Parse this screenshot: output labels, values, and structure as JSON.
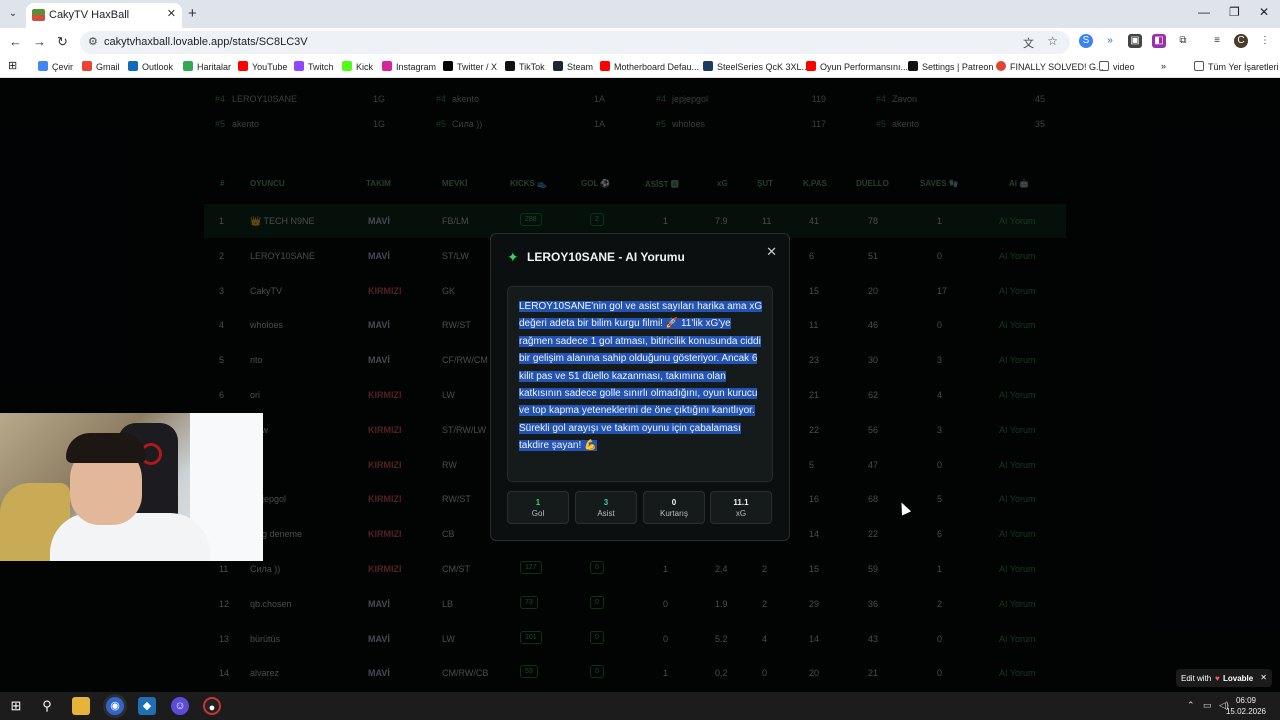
{
  "browser": {
    "tab_title": "CakyTV HaxBall",
    "url": "cakytvhaxball.lovable.app/stats/SC8LC3V",
    "bookmarks": [
      "Çevir",
      "Gmail",
      "Outlook",
      "Haritalar",
      "YouTube",
      "Twitch",
      "Kick",
      "Instagram",
      "Twitter / X",
      "TikTok",
      "Steam",
      "Motherboard Defau...",
      "SteelSeries QcK 3XL...",
      "Oyun Performansını...",
      "Settings | Patreon",
      "FINALLY SOLVED! G...",
      "video"
    ],
    "all_bookmarks": "Tüm Yer İşaretleri"
  },
  "podium": [
    [
      {
        "rank": "#4",
        "name": "LEROY10SANE",
        "val": "1G"
      },
      {
        "rank": "#4",
        "name": "akento",
        "val": "1A"
      },
      {
        "rank": "#4",
        "name": "jepjepgol",
        "val": "119"
      },
      {
        "rank": "#4",
        "name": "Zavon",
        "val": "45"
      }
    ],
    [
      {
        "rank": "#5",
        "name": "akento",
        "val": "1G"
      },
      {
        "rank": "#5",
        "name": "Сила ))",
        "val": "1A"
      },
      {
        "rank": "#5",
        "name": "wholoes",
        "val": "117"
      },
      {
        "rank": "#5",
        "name": "akento",
        "val": "35"
      }
    ]
  ],
  "table": {
    "headers": [
      "#",
      "OYUNCU",
      "TAKIM",
      "MEVKİ",
      "KICKS 👟",
      "GOL ⚽",
      "ASİST 🅰",
      "xG",
      "ŞUT",
      "K.PAS",
      "DÜELLO",
      "SAVES 🧤",
      "AI 🤖"
    ],
    "rows": [
      {
        "n": "1",
        "name": "👑 TECH N9NE",
        "team": "MAVİ",
        "pos": "FB/LM",
        "kicks": "288",
        "gol": "2",
        "asist": "1",
        "xg": "7.9",
        "sut": "11",
        "kpas": "41",
        "duel": "78",
        "saves": "1",
        "ai": "AI Yorum"
      },
      {
        "n": "2",
        "name": "LEROY10SANE",
        "team": "MAVİ",
        "pos": "ST/LW",
        "kicks": "",
        "gol": "",
        "asist": "",
        "xg": "",
        "sut": "",
        "kpas": "6",
        "duel": "51",
        "saves": "0",
        "ai": "AI Yorum"
      },
      {
        "n": "3",
        "name": "CakyTV",
        "team": "KIRMIZI",
        "pos": "GK",
        "kicks": "",
        "gol": "",
        "asist": "",
        "xg": "",
        "sut": "",
        "kpas": "15",
        "duel": "20",
        "saves": "17",
        "ai": "AI Yorum"
      },
      {
        "n": "4",
        "name": "wholoes",
        "team": "MAVİ",
        "pos": "RW/ST",
        "kicks": "",
        "gol": "",
        "asist": "",
        "xg": "",
        "sut": "",
        "kpas": "11",
        "duel": "46",
        "saves": "0",
        "ai": "AI Yorum"
      },
      {
        "n": "5",
        "name": "nto",
        "team": "MAVİ",
        "pos": "CF/RW/CM",
        "kicks": "",
        "gol": "",
        "asist": "",
        "xg": "",
        "sut": "",
        "kpas": "23",
        "duel": "30",
        "saves": "3",
        "ai": "AI Yorum"
      },
      {
        "n": "6",
        "name": "ori",
        "team": "KIRMIZI",
        "pos": "LW",
        "kicks": "",
        "gol": "",
        "asist": "",
        "xg": "",
        "sut": "",
        "kpas": "21",
        "duel": "62",
        "saves": "4",
        "ai": "AI Yorum"
      },
      {
        "n": "7",
        "name": "_sjw",
        "team": "KIRMIZI",
        "pos": "ST/RW/LW",
        "kicks": "",
        "gol": "",
        "asist": "",
        "xg": "",
        "sut": "",
        "kpas": "22",
        "duel": "56",
        "saves": "3",
        "ai": "AI Yorum"
      },
      {
        "n": "",
        "name": "rc",
        "team": "KIRMIZI",
        "pos": "RW",
        "kicks": "",
        "gol": "",
        "asist": "",
        "xg": "",
        "sut": "",
        "kpas": "5",
        "duel": "47",
        "saves": "0",
        "ai": "AI Yorum"
      },
      {
        "n": "9",
        "name": "jepjepgol",
        "team": "KIRMIZI",
        "pos": "RW/ST",
        "kicks": "",
        "gol": "",
        "asist": "",
        "xg": "",
        "sut": "",
        "kpas": "16",
        "duel": "68",
        "saves": "5",
        "ai": "AI Yorum"
      },
      {
        "n": "10",
        "name": "ping deneme",
        "team": "KIRMIZI",
        "pos": "CB",
        "kicks": "",
        "gol": "",
        "asist": "",
        "xg": "",
        "sut": "",
        "kpas": "14",
        "duel": "22",
        "saves": "6",
        "ai": "AI Yorum"
      },
      {
        "n": "11",
        "name": "Сила ))",
        "team": "KIRMIZI",
        "pos": "CM/ST",
        "kicks": "127",
        "gol": "0",
        "asist": "1",
        "xg": "2.4",
        "sut": "2",
        "kpas": "15",
        "duel": "59",
        "saves": "1",
        "ai": "AI Yorum"
      },
      {
        "n": "12",
        "name": "qb.chosen",
        "team": "MAVİ",
        "pos": "LB",
        "kicks": "73",
        "gol": "0",
        "asist": "0",
        "xg": "1.9",
        "sut": "2",
        "kpas": "29",
        "duel": "36",
        "saves": "2",
        "ai": "AI Yorum"
      },
      {
        "n": "13",
        "name": "bürütüs",
        "team": "MAVİ",
        "pos": "LW",
        "kicks": "101",
        "gol": "0",
        "asist": "0",
        "xg": "5.2",
        "sut": "4",
        "kpas": "14",
        "duel": "43",
        "saves": "0",
        "ai": "AI Yorum"
      },
      {
        "n": "14",
        "name": "alvarez",
        "team": "MAVİ",
        "pos": "CM/RW/CB",
        "kicks": "53",
        "gol": "0",
        "asist": "1",
        "xg": "0.2",
        "sut": "0",
        "kpas": "20",
        "duel": "21",
        "saves": "0",
        "ai": "AI Yorum"
      }
    ]
  },
  "modal": {
    "title": "LEROY10SANE - AI Yorumu",
    "text": "LEROY10SANE'nin gol ve asist sayıları harika ama xG değeri adeta bir bilim kurgu filmi! 🚀 11'lik xG'ye rağmen sadece 1 gol atması, bitiricilik konusunda ciddi bir gelişim alanına sahip olduğunu gösteriyor. Ancak 6 kilit pas ve 51 düello kazanması, takımına olan katkısının sadece golle sınırlı olmadığını, oyun kurucu ve top kapma yeteneklerini de öne çıktığını kanıtlıyor. Sürekli gol arayışı ve takım oyunu için çabalaması takdire şayan! 💪",
    "stats": [
      {
        "value": "1",
        "label": "Gol",
        "color": "#37d071"
      },
      {
        "value": "3",
        "label": "Asist",
        "color": "#3ec7a8"
      },
      {
        "value": "0",
        "label": "Kurtarış",
        "color": "#f2f2f2"
      },
      {
        "value": "11.1",
        "label": "xG",
        "color": "#f2f2f2"
      }
    ]
  },
  "lovable": {
    "edit": "Edit with",
    "brand": "Lovable"
  },
  "clock": {
    "time": "06:09",
    "date": "15.02.2026"
  }
}
